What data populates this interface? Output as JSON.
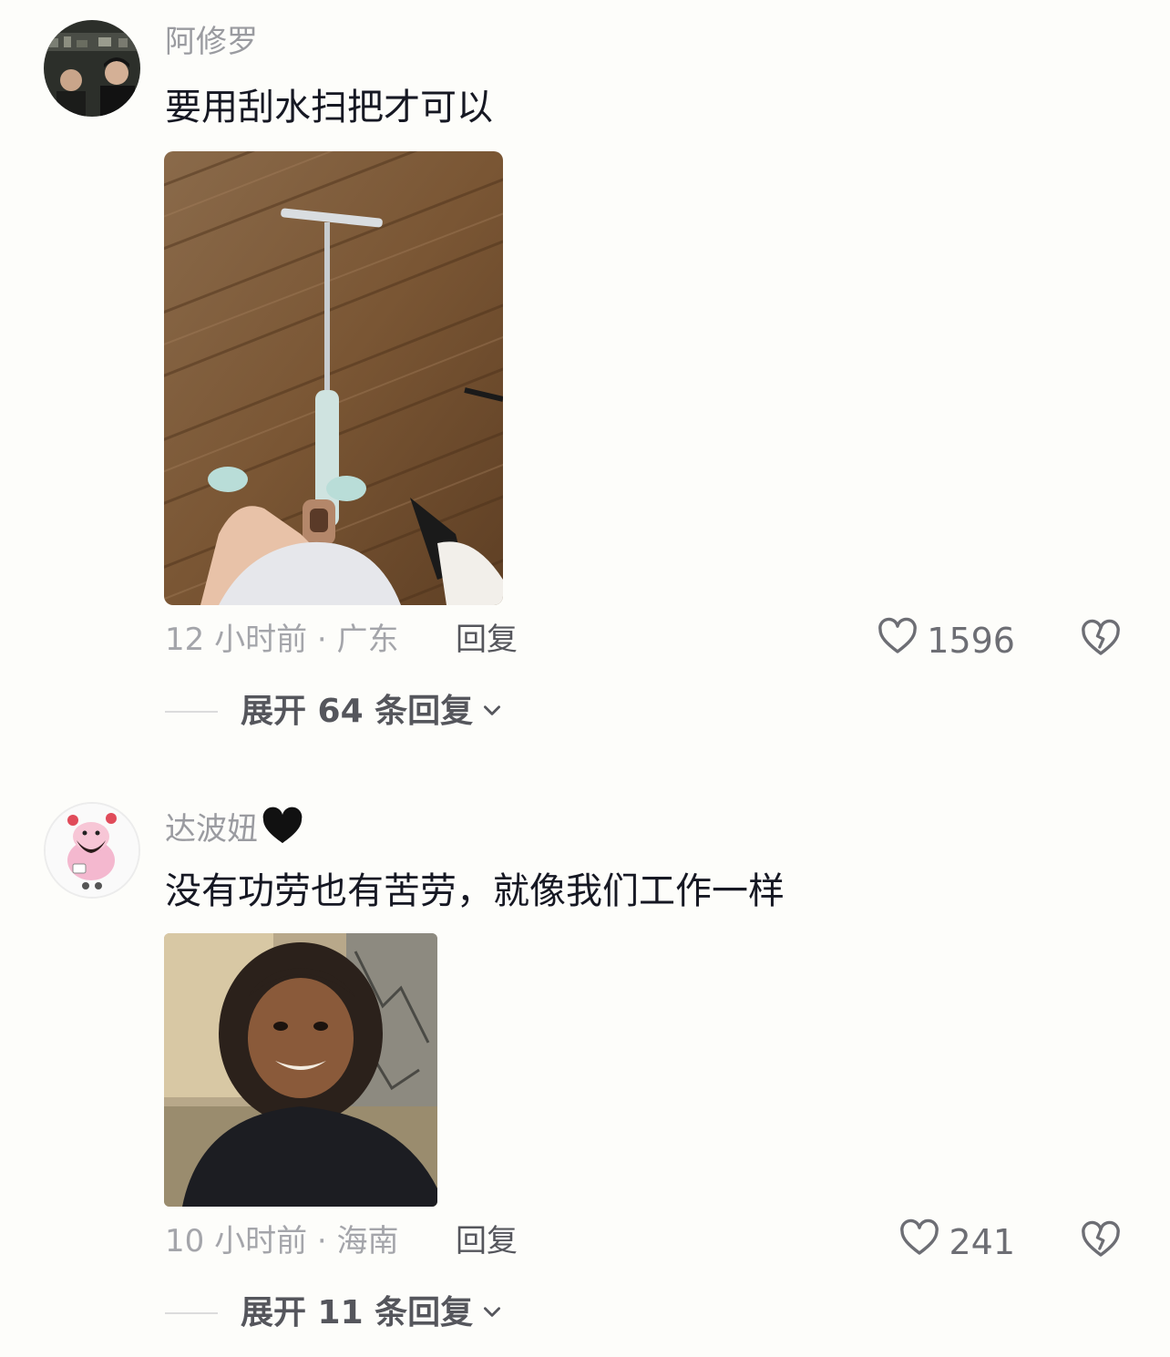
{
  "comments": [
    {
      "username": "阿修罗",
      "text": "要用刮水扫把才可以",
      "time_location": "12 小时前 · 广东",
      "reply_label": "回复",
      "likes": "1596",
      "expand_label": "展开 64 条回复"
    },
    {
      "username": "达波妞",
      "text": "没有功劳也有苦劳，就像我们工作一样",
      "time_location": "10 小时前 · 海南",
      "reply_label": "回复",
      "likes": "241",
      "expand_label": "展开 11 条回复"
    }
  ]
}
